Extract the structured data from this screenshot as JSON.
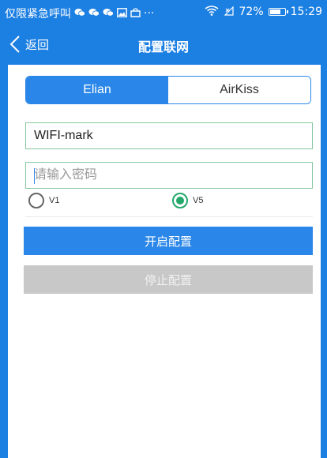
{
  "status_bar": {
    "left_text": "仅限紧急呼叫",
    "icons_left": [
      "wechat-icon",
      "wechat-icon",
      "wechat-icon",
      "image-icon",
      "bag-icon",
      "more-icon"
    ],
    "ellipsis": "···",
    "wifi_icon": "wifi-icon",
    "signal_icon": "no-signal-icon",
    "battery_percent_text": "72%",
    "battery_level": 0.72,
    "time": "15:29"
  },
  "nav": {
    "back_label": "返回",
    "title": "配置联网"
  },
  "segment": {
    "options": [
      "Elian",
      "AirKiss"
    ],
    "selected": "Elian"
  },
  "form": {
    "ssid_value": "WIFI-mark",
    "password_placeholder": "请输入密码",
    "password_value": ""
  },
  "version": {
    "options": [
      "V1",
      "V5"
    ],
    "selected": "V5"
  },
  "buttons": {
    "start": "开启配置",
    "stop": "停止配置"
  },
  "colors": {
    "brand_blue": "#1c7fe2",
    "accent_blue": "#2a86e8",
    "radio_green": "#22a86b",
    "disabled_gray": "#c8c8c8"
  }
}
